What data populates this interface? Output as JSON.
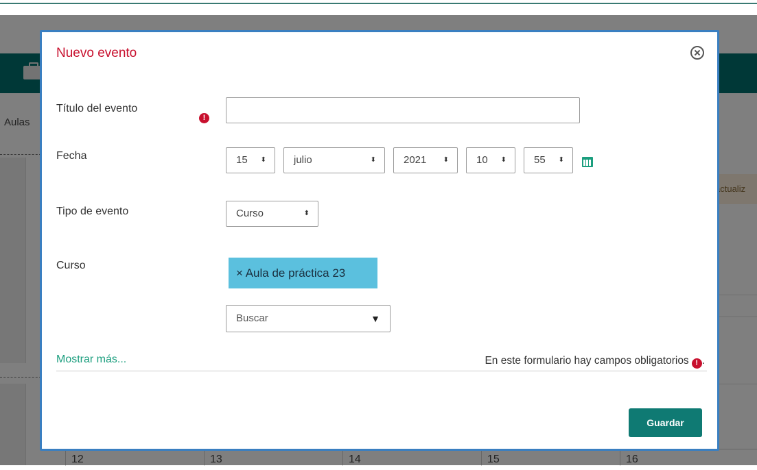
{
  "background": {
    "breadcrumb": "Aulas",
    "notice": "actualiz",
    "calendar_days": [
      "12",
      "13",
      "14",
      "15",
      "16"
    ]
  },
  "modal": {
    "title": "Nuevo evento",
    "close_icon": "close-circle-icon",
    "fields": {
      "title_label": "Título del evento",
      "title_value": "",
      "date_label": "Fecha",
      "day": "15",
      "month": "julio",
      "year": "2021",
      "hour": "10",
      "minute": "55",
      "type_label": "Tipo de evento",
      "type_value": "Curso",
      "course_label": "Curso",
      "course_tag": "× Aula de práctica 23",
      "search_placeholder": "Buscar"
    },
    "show_more": "Mostrar más...",
    "required_note": "En este formulario hay campos obligatorios",
    "required_note_end": ".",
    "required_glyph": "!",
    "save_label": "Guardar"
  },
  "colors": {
    "title": "#c8102e",
    "accent": "#1b9e7e",
    "button": "#0f7a73",
    "tag": "#5bc0de",
    "modal_border": "#3a7fc1"
  }
}
